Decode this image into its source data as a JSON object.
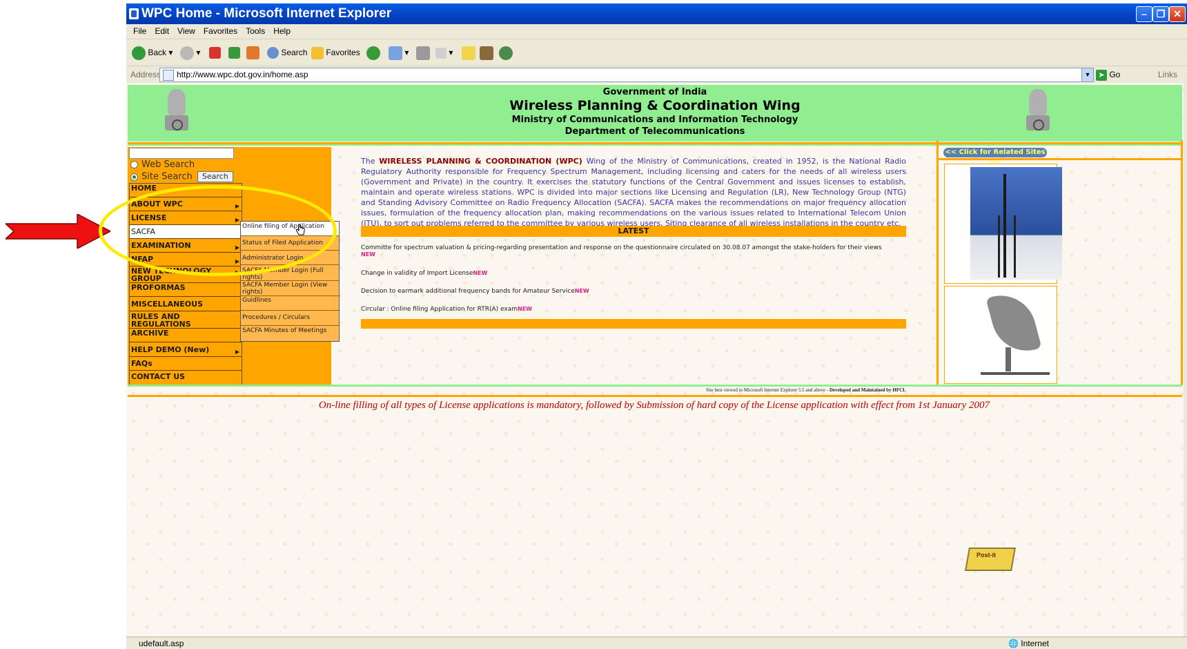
{
  "window": {
    "title": "WPC Home - Microsoft Internet Explorer"
  },
  "menubar": [
    "File",
    "Edit",
    "View",
    "Favorites",
    "Tools",
    "Help"
  ],
  "toolbar": {
    "back": "Back",
    "search": "Search",
    "favorites": "Favorites"
  },
  "address": {
    "label": "Address",
    "url": "http://www.wpc.dot.gov.in/home.asp",
    "go": "Go",
    "links": "Links"
  },
  "header": {
    "gov": "Government of India",
    "wing": "Wireless Planning & Coordination Wing",
    "ministry": "Ministry of Communications and Information Technology",
    "dept": "Department of Telecommunications"
  },
  "search": {
    "web_label": "Web Search",
    "site_label": "Site Search",
    "button": "Search"
  },
  "nav": [
    {
      "label": "HOME"
    },
    {
      "label": "ABOUT WPC"
    },
    {
      "label": "LICENSE"
    },
    {
      "label": "SACFA"
    },
    {
      "label": "EXAMINATION"
    },
    {
      "label": "NFAP"
    },
    {
      "label": "NEW TECHNOLOGY GROUP"
    },
    {
      "label": "PROFORMAS"
    },
    {
      "label": "MISCELLANEOUS"
    },
    {
      "label": "RULES AND REGULATIONS"
    },
    {
      "label": "ARCHIVE"
    },
    {
      "label": "HELP DEMO (New)"
    },
    {
      "label": "FAQs"
    },
    {
      "label": "CONTACT US"
    }
  ],
  "submenu": [
    {
      "label": "Online filing of Application"
    },
    {
      "label": "Status of Filed Application"
    },
    {
      "label": "Administrator Login"
    },
    {
      "label": "SACFA Member Login (Full rights)"
    },
    {
      "label": "SACFA Member Login (View rights)"
    },
    {
      "label": "Guidlines"
    },
    {
      "label": "Procedures / Circulars"
    },
    {
      "label": "SACFA Minutes of Meetings"
    }
  ],
  "intro": {
    "lead": "The ",
    "bold": "WIRELESS PLANNING & COORDINATION (WPC)",
    "text": " Wing of the Ministry of Communications, created in 1952, is the National Radio Regulatory Authority responsible for Frequency Spectrum Management, including licensing and caters for the needs of all wireless users (Government and Private) in the country. It exercises the statutory functions of the Central Government and issues licenses to establish, maintain and operate wireless stations. WPC is divided into major sections like Licensing and Regulation (LR), New Technology Group (NTG) and Standing Advisory Committee on Radio Frequency Allocation (SACFA). SACFA makes the recommendations on major frequency allocation issues, formulation of the frequency allocation plan, making recommendations on the various issues related to International Telecom Union (ITU), to sort out problems referred to the committee by various wireless users, Siting clearance of all wireless installations in the country etc."
  },
  "latest": {
    "title": "LATEST",
    "new_badge": "NEW",
    "items": [
      "Committe for spectrum valuation & pricing-regarding presentation and response on the questionnaire circulated on 30.08.07 amongst the stake-holders for their views",
      "Change in validity of Import License",
      "Decision to earmark additional frequency bands for Amateur Service",
      "Circular : Online filing Application for RTR(A) exam"
    ]
  },
  "right": {
    "related_sites": "<< Click for Related Sites >>"
  },
  "footer": {
    "best_viewed": "Site best viewed in Microsoft Internet Explorer 5.5 and above",
    "developed": "- Developed and Maintained by HFCL",
    "mandatory": "On-line filling of all types of License applications is mandatory, followed by Submission of hard copy of the License application with effect from 1st January 2007",
    "postit": "Post-it"
  },
  "status": {
    "text": "udefault.asp",
    "zone": "Internet"
  },
  "colors": {
    "header_bg": "#90ee90",
    "nav_bg": "#ffa500",
    "highlight_oval": "#ffea00",
    "arrow": "#ee1111",
    "mandatory_text": "#c00000"
  }
}
